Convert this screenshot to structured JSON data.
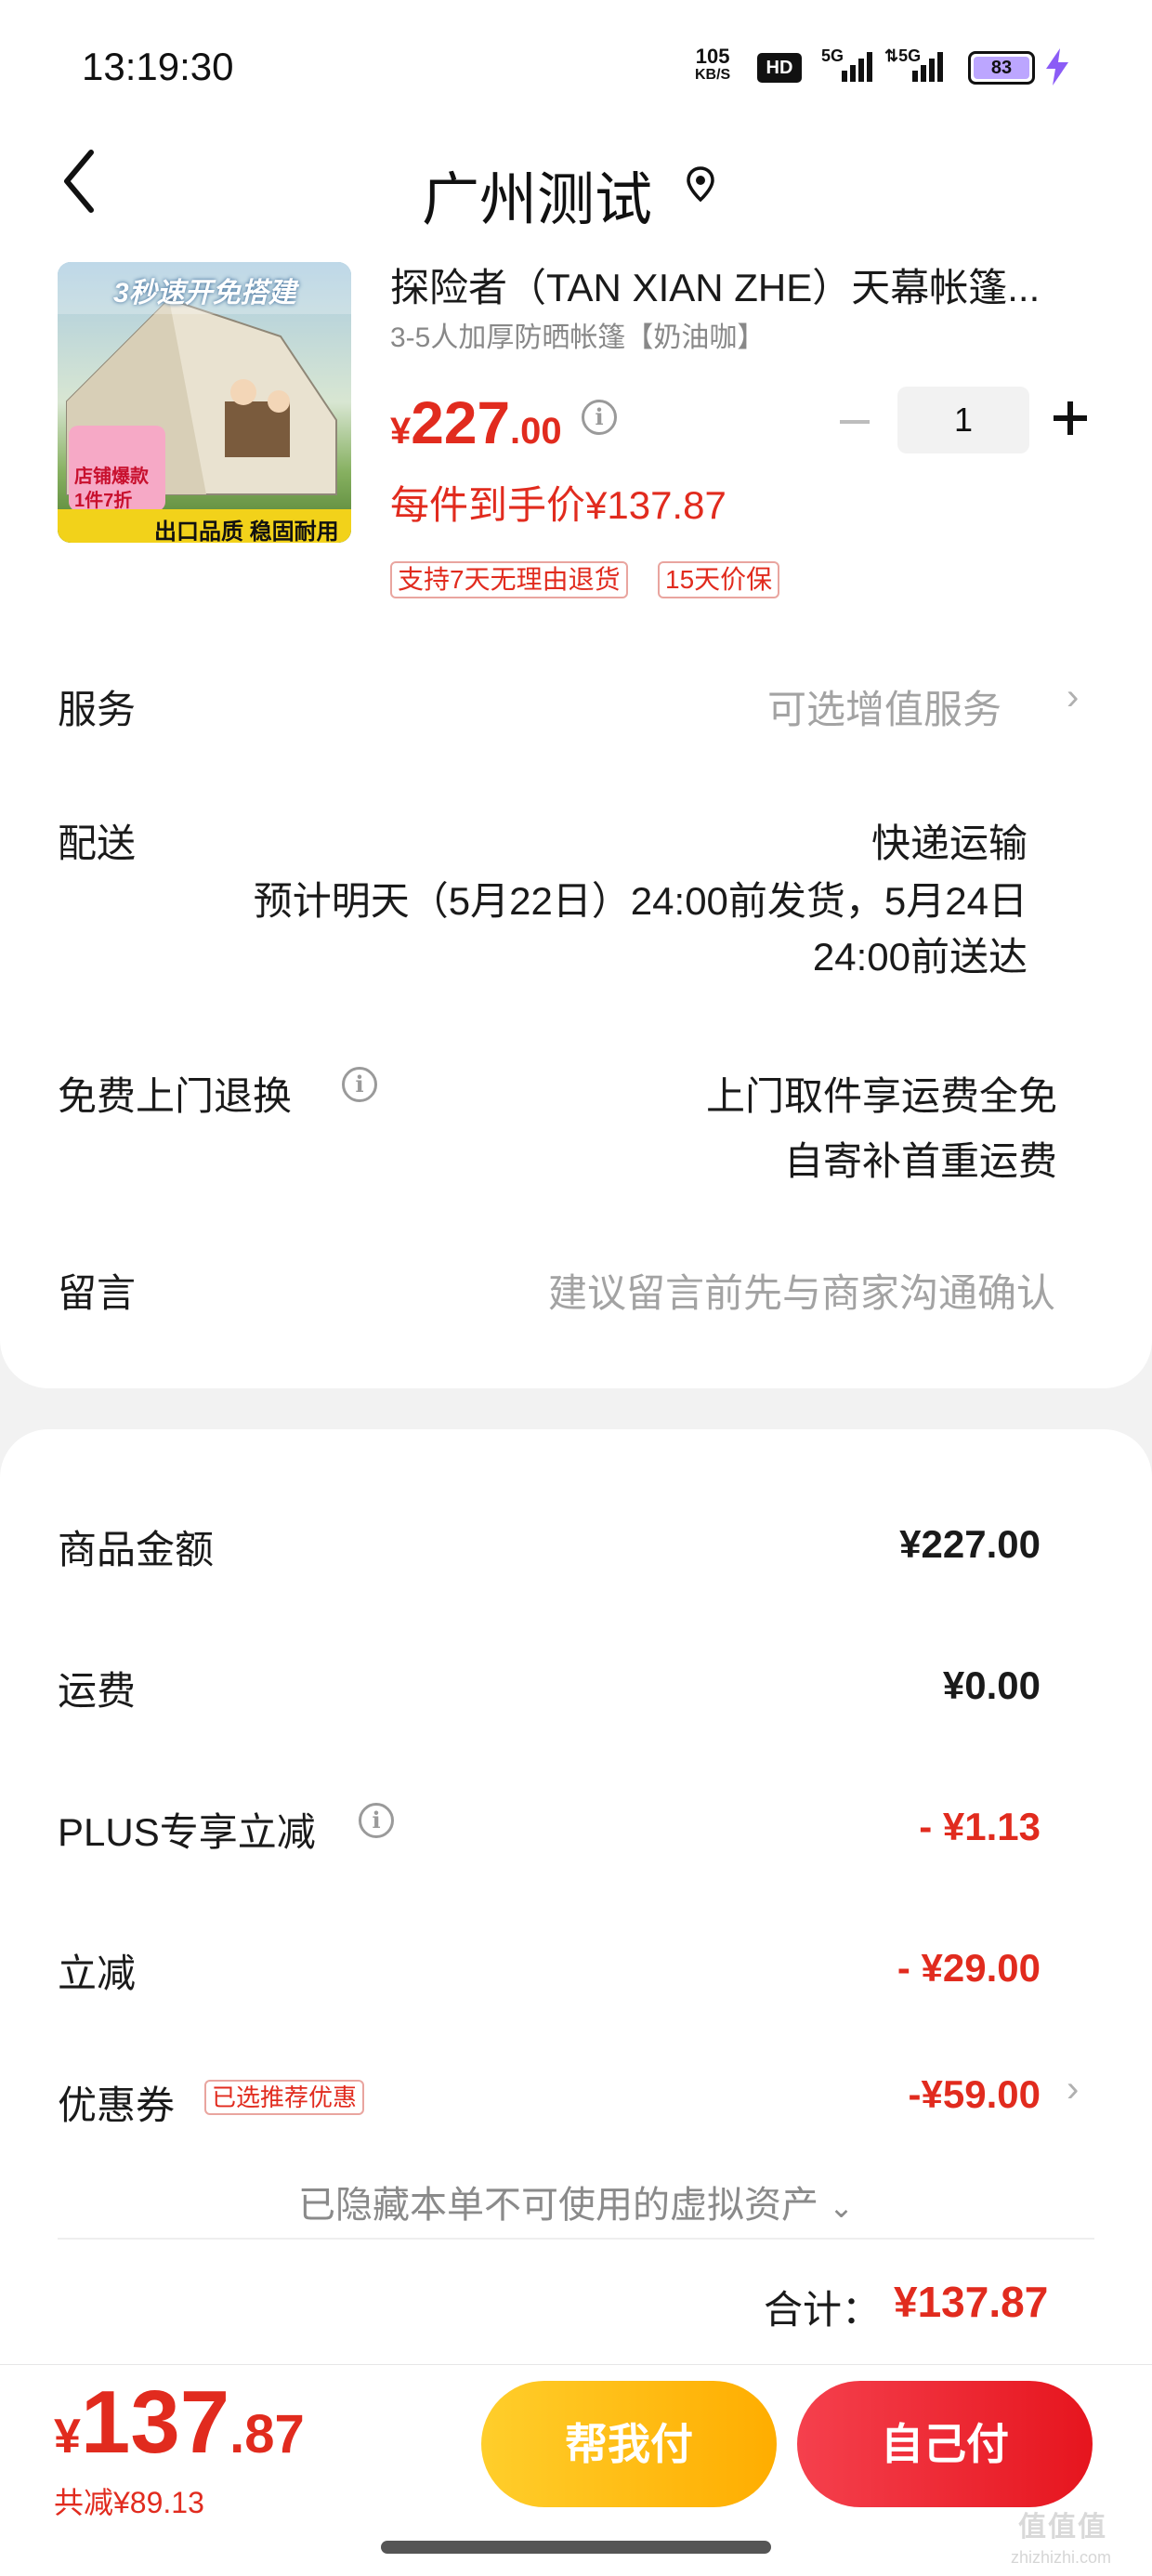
{
  "status_bar": {
    "time": "13:19:30",
    "net_speed_value": "105",
    "net_speed_unit": "KB/S",
    "hd_badge": "HD",
    "signal1": "5G",
    "signal2": "5G",
    "battery": "83"
  },
  "header": {
    "title": "广州测试"
  },
  "product": {
    "name": "探险者（TAN XIAN ZHE）天幕帐篷...",
    "spec": "3-5人加厚防晒帐篷【奶油咖】",
    "price_currency": "¥",
    "price_int": "227",
    "price_dec": ".00",
    "quantity": "1",
    "each_price": "每件到手价¥137.87",
    "tags": [
      "支持7天无理由退货",
      "15天价保"
    ],
    "image_caption": "3秒速开免搭建",
    "image_badge1": "店铺爆款",
    "image_badge2": "1件7折",
    "image_banner": "出口品质 稳固耐用"
  },
  "rows": {
    "service_label": "服务",
    "service_value": "可选增值服务",
    "delivery_label": "配送",
    "delivery_method": "快递运输",
    "delivery_line1": "预计明天（5月22日）24:00前发货，5月24日",
    "delivery_line2": "24:00前送达",
    "return_label": "免费上门退换",
    "return_line1": "上门取件享运费全免",
    "return_line2": "自寄补首重运费",
    "message_label": "留言",
    "message_placeholder": "建议留言前先与商家沟通确认"
  },
  "summary": {
    "goods_label": "商品金额",
    "goods_value": "¥227.00",
    "shipping_label": "运费",
    "shipping_value": "¥0.00",
    "plus_label": "PLUS专享立减",
    "plus_value": "- ¥1.13",
    "instant_label": "立减",
    "instant_value": "- ¥29.00",
    "coupon_label": "优惠券",
    "coupon_tag": "已选推荐优惠",
    "coupon_value": "-¥59.00",
    "hidden_assets": "已隐藏本单不可使用的虚拟资产",
    "total_label": "合计：",
    "total_value": "¥137.87"
  },
  "bottom_bar": {
    "price_currency": "¥",
    "price_int": "137",
    "price_dec": ".87",
    "saved": "共减¥89.13",
    "help_pay_label": "帮我付",
    "self_pay_label": "自己付"
  },
  "watermark": {
    "brand": "值值值",
    "domain": "zhizhizhi.com"
  },
  "colors": {
    "accent_red": "#e12b1e",
    "help_pay_yellow": "#ffb800",
    "self_pay_red": "#ef2b33"
  }
}
